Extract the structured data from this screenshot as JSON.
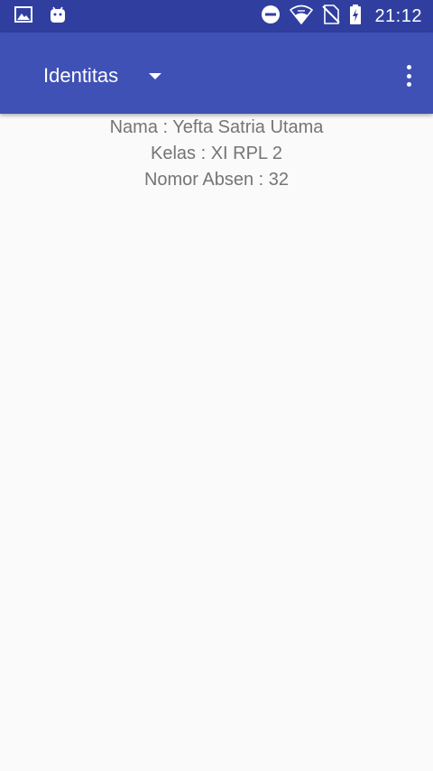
{
  "status_bar": {
    "time": "21:12",
    "left_icons": [
      "image-icon",
      "android-icon"
    ],
    "right_icons": [
      "do-not-disturb-icon",
      "wifi-icon",
      "no-sim-icon",
      "battery-charging-icon"
    ]
  },
  "app_bar": {
    "spinner_label": "Identitas",
    "spinner_icon": "dropdown-arrow-icon",
    "overflow_icon": "more-vert-icon",
    "color": "#3f51b5",
    "status_color": "#303f9f"
  },
  "content": {
    "nama": "Nama : Yefta Satria Utama",
    "kelas": "Kelas : XI RPL 2",
    "nomor_absen": "Nomor Absen : 32",
    "text_color": "#757575"
  }
}
